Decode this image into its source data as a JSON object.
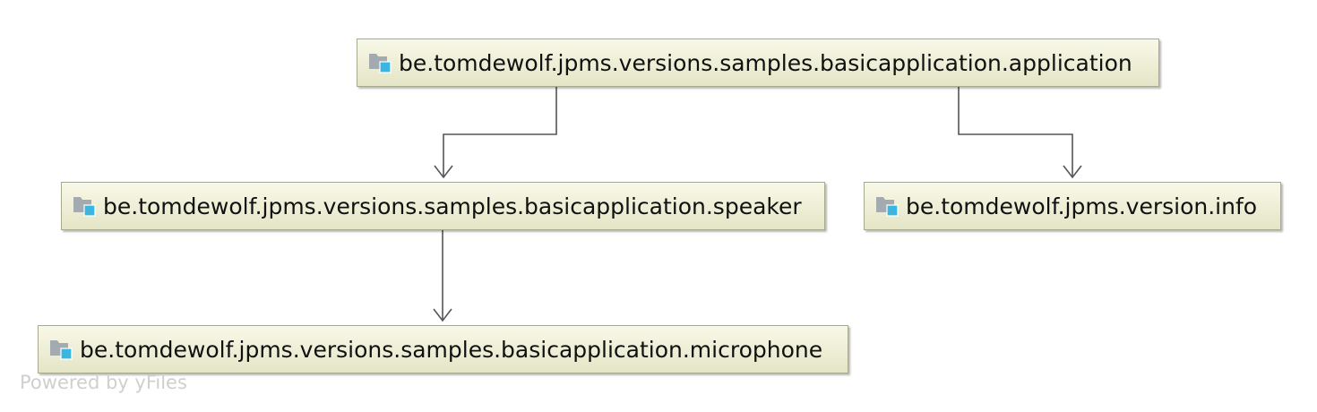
{
  "diagram": {
    "nodes": {
      "application": {
        "label": "be.tomdewolf.jpms.versions.samples.basicapplication.application",
        "icon": "module-folder-icon"
      },
      "speaker": {
        "label": "be.tomdewolf.jpms.versions.samples.basicapplication.speaker",
        "icon": "module-folder-icon"
      },
      "versioninfo": {
        "label": "be.tomdewolf.jpms.version.info",
        "icon": "module-folder-icon"
      },
      "microphone": {
        "label": "be.tomdewolf.jpms.versions.samples.basicapplication.microphone",
        "icon": "module-folder-icon"
      }
    },
    "edges": [
      {
        "from": "application",
        "to": "speaker"
      },
      {
        "from": "application",
        "to": "versioninfo"
      },
      {
        "from": "speaker",
        "to": "microphone"
      }
    ],
    "watermark": "Powered by yFiles"
  },
  "colors": {
    "node_fill": "#eeeed6",
    "node_border": "#a9a98e",
    "edge": "#555555",
    "icon_folder": "#a3abb0",
    "icon_badge": "#3bb6e0"
  }
}
